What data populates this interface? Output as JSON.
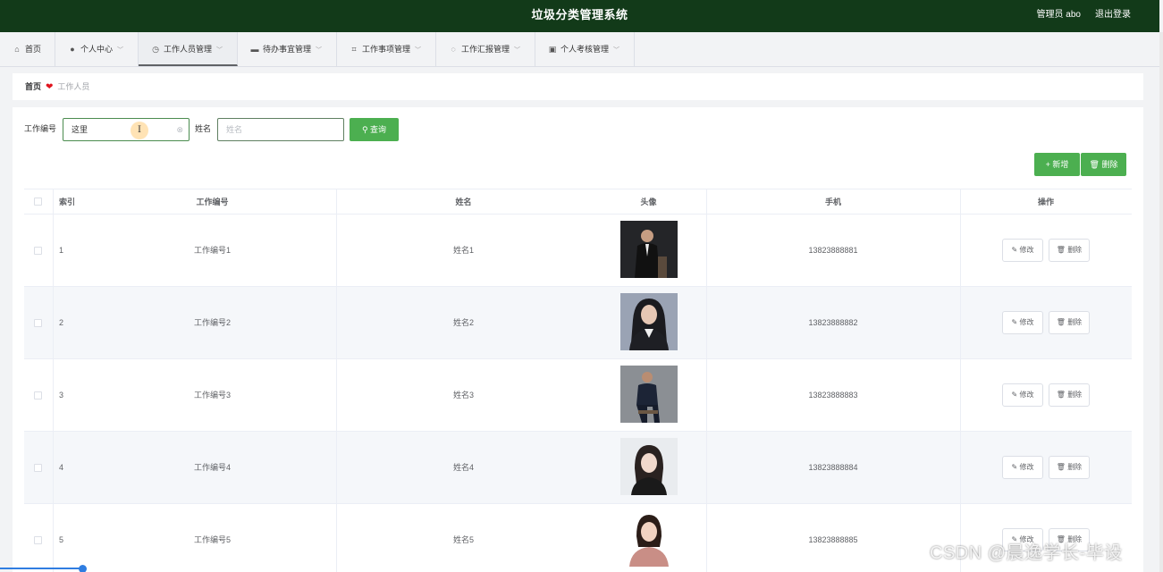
{
  "header": {
    "title": "垃圾分类管理系统",
    "user": "管理员 abo",
    "logout": "退出登录",
    "bg_color": "#123a19"
  },
  "nav": [
    {
      "label": "首页",
      "icon": "home-icon",
      "active": false,
      "dropdown": false
    },
    {
      "label": "个人中心",
      "icon": "user-icon",
      "active": false,
      "dropdown": true
    },
    {
      "label": "工作人员管理",
      "icon": "clock-icon",
      "active": true,
      "dropdown": true
    },
    {
      "label": "待办事宜管理",
      "icon": "chat-icon",
      "active": false,
      "dropdown": true
    },
    {
      "label": "工作事项管理",
      "icon": "crop-icon",
      "active": false,
      "dropdown": true
    },
    {
      "label": "工作汇报管理",
      "icon": "compass-icon",
      "active": false,
      "dropdown": true
    },
    {
      "label": "个人考核管理",
      "icon": "briefcase-icon",
      "active": false,
      "dropdown": true
    }
  ],
  "breadcrumb": {
    "home": "首页",
    "current": "工作人员"
  },
  "search": {
    "code_label": "工作编号",
    "code_value": "这里",
    "name_label": "姓名",
    "name_placeholder": "姓名",
    "query_button": "查询"
  },
  "actions": {
    "add": "新增",
    "delete": "删除"
  },
  "table": {
    "columns": [
      "索引",
      "工作编号",
      "姓名",
      "头像",
      "手机",
      "操作"
    ],
    "rows": [
      {
        "index": "1",
        "code": "工作编号1",
        "name": "姓名1",
        "phone": "13823888881"
      },
      {
        "index": "2",
        "code": "工作编号2",
        "name": "姓名2",
        "phone": "13823888882"
      },
      {
        "index": "3",
        "code": "工作编号3",
        "name": "姓名3",
        "phone": "13823888883"
      },
      {
        "index": "4",
        "code": "工作编号4",
        "name": "姓名4",
        "phone": "13823888884"
      },
      {
        "index": "5",
        "code": "工作编号5",
        "name": "姓名5",
        "phone": "13823888885"
      }
    ],
    "row_edit": "修改",
    "row_delete": "删除"
  },
  "watermark": "CSDN @晨逸学长-毕设",
  "progress": 1.0,
  "colors": {
    "accent": "#4caf50",
    "header": "#123a19",
    "heart": "#e0141e"
  }
}
